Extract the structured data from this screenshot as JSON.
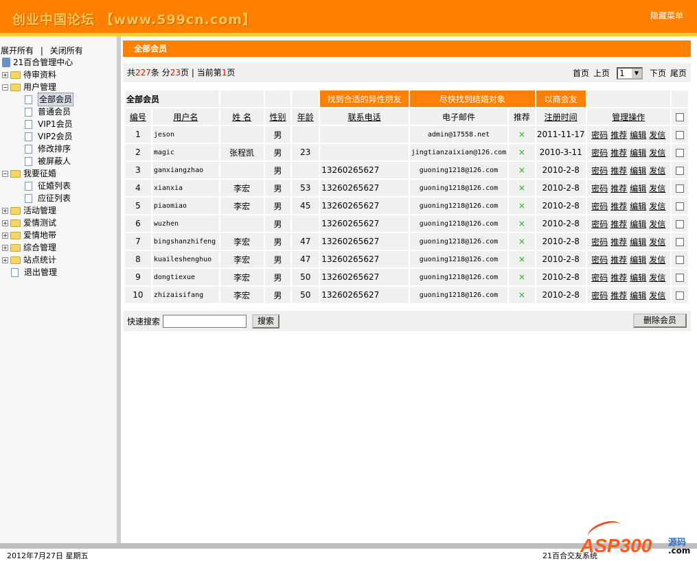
{
  "header": {
    "logo_text": "创业中国论坛 【www.599cn.com】",
    "hide_menu": "隐藏菜单",
    "accent": "#ff7f00",
    "stripe": "#ffcc33"
  },
  "sidebar": {
    "expand_all": "展开所有",
    "separator": "|",
    "collapse_all": "关闭所有",
    "root": "21百合管理中心",
    "tree": [
      {
        "label": "待审资料",
        "type": "folder",
        "expanded": false
      },
      {
        "label": "用户管理",
        "type": "folder",
        "expanded": true,
        "children": [
          {
            "label": "全部会员",
            "selected": true
          },
          {
            "label": "普通会员"
          },
          {
            "label": "VIP1会员"
          },
          {
            "label": "VIP2会员"
          },
          {
            "label": "修改排序"
          },
          {
            "label": "被屏蔽人"
          }
        ]
      },
      {
        "label": "我要征婚",
        "type": "folder",
        "expanded": true,
        "children": [
          {
            "label": "征婚列表"
          },
          {
            "label": "应征列表"
          }
        ]
      },
      {
        "label": "活动管理",
        "type": "folder",
        "expanded": false
      },
      {
        "label": "爱情测试",
        "type": "folder",
        "expanded": false
      },
      {
        "label": "爱情地带",
        "type": "folder",
        "expanded": false
      },
      {
        "label": "综合管理",
        "type": "folder",
        "expanded": false
      },
      {
        "label": "站点统计",
        "type": "folder",
        "expanded": false
      },
      {
        "label": "退出管理",
        "type": "file"
      }
    ]
  },
  "main": {
    "title_dots": "::",
    "title": "全部会员",
    "info": {
      "p1": "共",
      "total": "227",
      "p2": "条 分",
      "pages": "23",
      "p3": "页 | 当前第",
      "current": "1",
      "p4": "页"
    },
    "pager": {
      "first": "首页",
      "prev": "上页",
      "page_select": "1",
      "next": "下页",
      "last": "尾页"
    },
    "table": {
      "caption": "全部会员",
      "filters": [
        "找到合适的异性朋友",
        "尽快找到结婚对象",
        "以商会友"
      ],
      "columns": [
        "编号",
        "用户名",
        "姓 名",
        "性别",
        "年龄",
        "联系电话",
        "电子邮件",
        "推荐",
        "注册时间",
        "管理操作"
      ],
      "ops": [
        "密码",
        "推荐",
        "编辑",
        "发信"
      ],
      "recommend_mark": "×",
      "rows": [
        [
          "1",
          "jeson",
          "",
          "男",
          "",
          "",
          "admin@17558.net",
          "2011-11-17"
        ],
        [
          "2",
          "magic",
          "张程凯",
          "男",
          "23",
          "",
          "jingtianzaixian@126.com",
          "2010-3-11"
        ],
        [
          "3",
          "ganxiangzhao",
          "",
          "男",
          "",
          "13260265627",
          "guoning1218@126.com",
          "2010-2-8"
        ],
        [
          "4",
          "xianxia",
          "李宏",
          "男",
          "53",
          "13260265627",
          "guoning1218@126.com",
          "2010-2-8"
        ],
        [
          "5",
          "piaomiao",
          "李宏",
          "男",
          "45",
          "13260265627",
          "guoning1218@126.com",
          "2010-2-8"
        ],
        [
          "6",
          "wuzhen",
          "",
          "男",
          "",
          "13260265627",
          "guoning1218@126.com",
          "2010-2-8"
        ],
        [
          "7",
          "bingshanzhifeng",
          "李宏",
          "男",
          "47",
          "13260265627",
          "guoning1218@126.com",
          "2010-2-8"
        ],
        [
          "8",
          "kuaileshenghuo",
          "李宏",
          "男",
          "47",
          "13260265627",
          "guoning1218@126.com",
          "2010-2-8"
        ],
        [
          "9",
          "dongtiexue",
          "李宏",
          "男",
          "50",
          "13260265627",
          "guoning1218@126.com",
          "2010-2-8"
        ],
        [
          "10",
          "zhizaisifang",
          "李宏",
          "男",
          "50",
          "13260265627",
          "guoning1218@126.com",
          "2010-2-8"
        ]
      ]
    },
    "search": {
      "label": "快速搜索",
      "value": "",
      "button": "搜索"
    },
    "delete_button": "删除会员"
  },
  "footer": {
    "date": "2012年7月27日 星期五",
    "right": "21百合交友系统"
  },
  "watermark": {
    "text": "ASP300源码.com"
  }
}
